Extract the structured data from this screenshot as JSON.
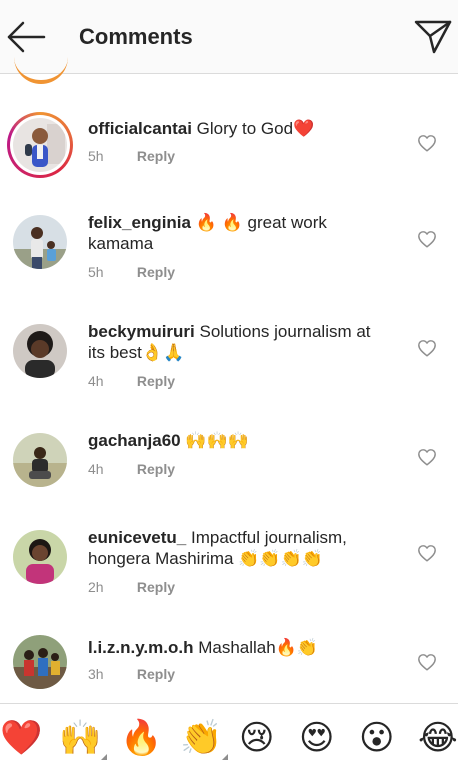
{
  "header": {
    "title": "Comments",
    "back_icon": "arrow-left-icon",
    "send_icon": "paper-plane-icon"
  },
  "comments": [
    {
      "username": "officialcantai",
      "text": "Glory to God❤️",
      "time": "5h",
      "reply": "Reply",
      "has_story_ring": true
    },
    {
      "username": "felix_enginia",
      "text": "🔥 🔥 great work kamama",
      "time": "5h",
      "reply": "Reply"
    },
    {
      "username": "beckymuiruri",
      "text": "Solutions journalism at its best👌🙏",
      "time": "4h",
      "reply": "Reply"
    },
    {
      "username": "gachanja60",
      "text": "🙌🙌🙌",
      "time": "4h",
      "reply": "Reply"
    },
    {
      "username": "eunicevetu_",
      "text": "Impactful journalism, hongera Mashirima 👏👏👏👏",
      "time": "2h",
      "reply": "Reply"
    },
    {
      "username": "l.i.z.n.y.m.o.h",
      "text": "Mashallah🔥👏",
      "time": "3h",
      "reply": "Reply"
    }
  ],
  "emoji_bar": [
    {
      "glyph": "❤️",
      "name": "red-heart"
    },
    {
      "glyph": "🙌",
      "name": "raising-hands",
      "has_variants": true
    },
    {
      "glyph": "🔥",
      "name": "fire"
    },
    {
      "glyph": "👏",
      "name": "clapping-hands",
      "has_variants": true
    },
    {
      "glyph": "😢",
      "name": "crying-face"
    },
    {
      "glyph": "😍",
      "name": "heart-eyes"
    },
    {
      "glyph": "😮",
      "name": "surprised-face"
    },
    {
      "glyph": "😂",
      "name": "tears-of-joy"
    }
  ],
  "colors": {
    "text": "#262626",
    "secondary_text": "#8e8e8e",
    "divider": "#dbdbdb",
    "header_bg": "#fafafa",
    "story_ring_start": "#f09433",
    "story_ring_end": "#bc1888"
  }
}
